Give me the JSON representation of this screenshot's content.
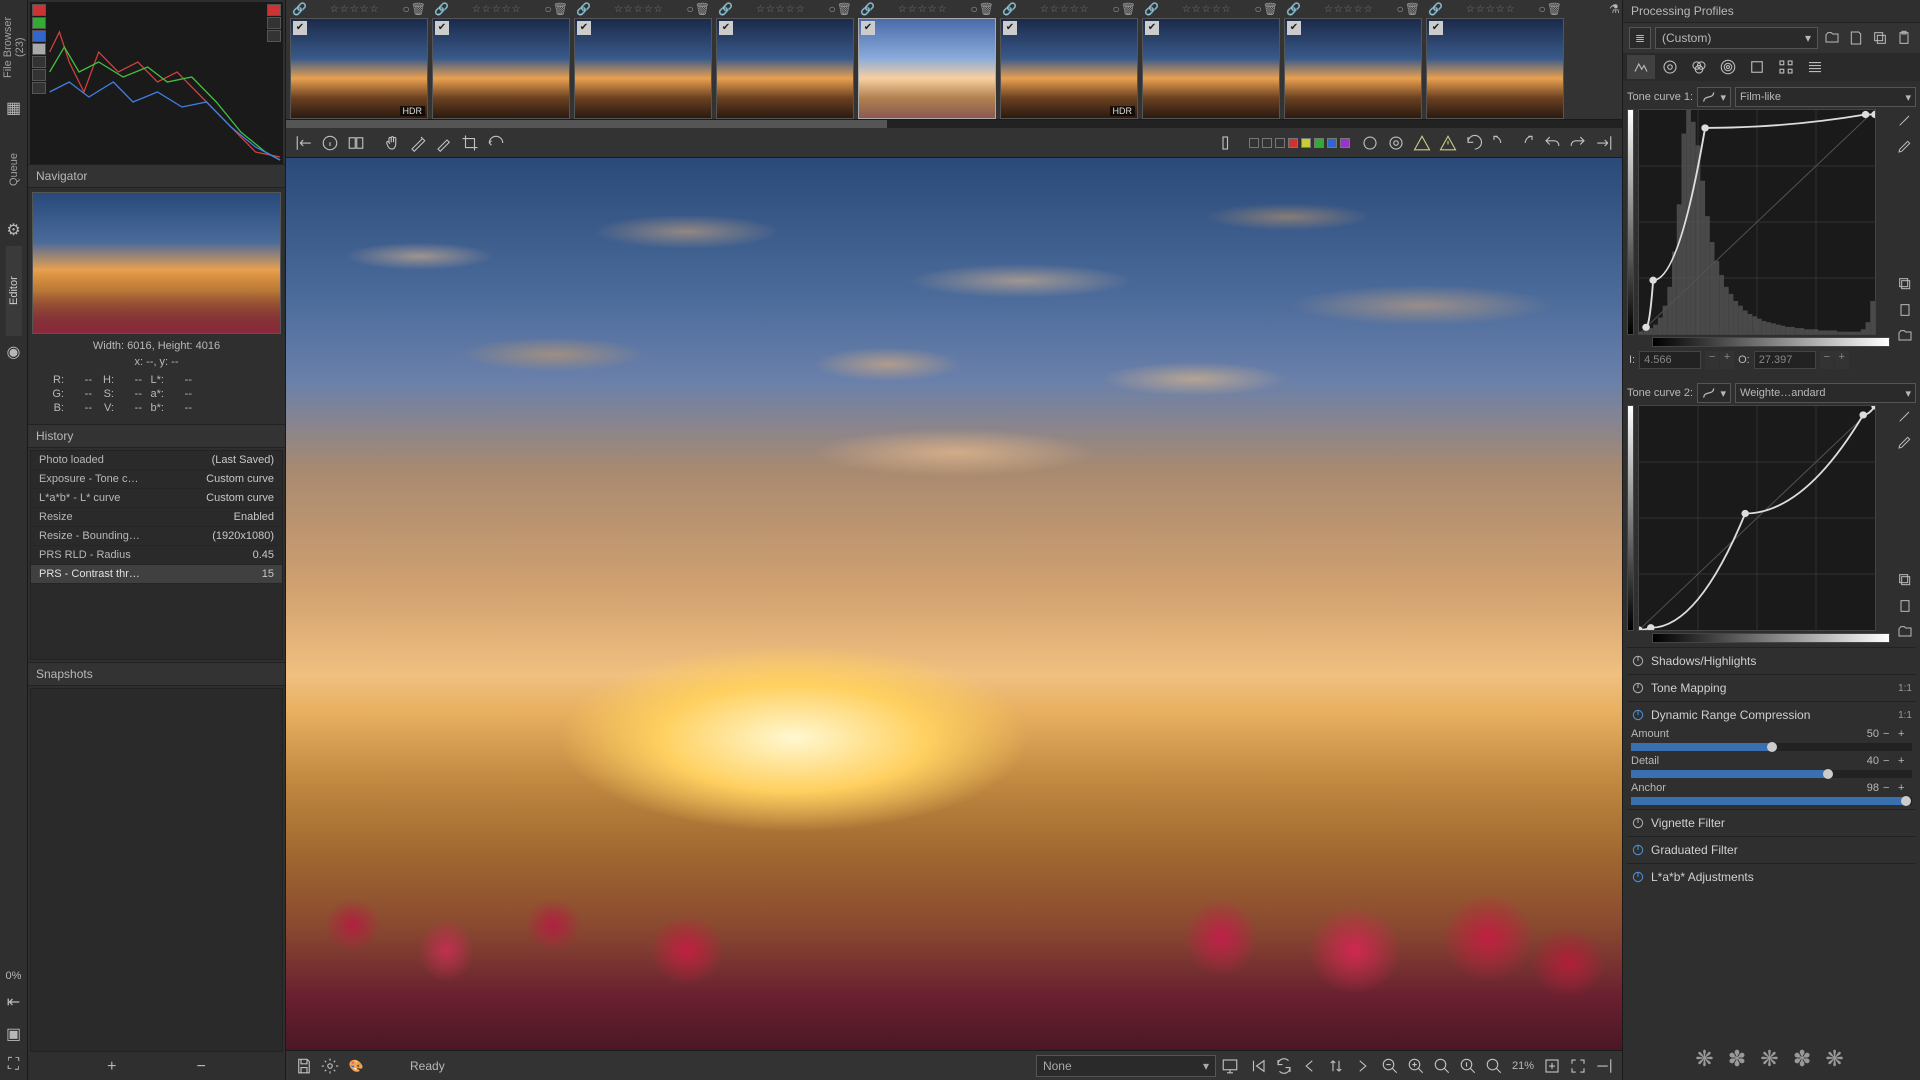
{
  "leftbar": {
    "tabs": [
      "File Browser (23)",
      "Queue",
      "Editor"
    ],
    "active_tab": 2,
    "queue_pct": "0%"
  },
  "navigator": {
    "title": "Navigator",
    "dimensions": "Width: 6016, Height: 4016",
    "xy": "x: --, y: --",
    "r_label": "R:",
    "r_val": "--",
    "g_label": "G:",
    "g_val": "--",
    "b_label": "B:",
    "b_val": "--",
    "h_label": "H:",
    "h_val": "--",
    "s_label": "S:",
    "s_val": "--",
    "v_label": "V:",
    "v_val": "--",
    "l_label": "L*:",
    "l_val": "--",
    "a_label": "a*:",
    "a_val": "--",
    "bb_label": "b*:",
    "bb_val": "--"
  },
  "history": {
    "title": "History",
    "items": [
      {
        "label": "Photo loaded",
        "value": "(Last Saved)"
      },
      {
        "label": "Exposure - Tone c…",
        "value": "Custom curve"
      },
      {
        "label": "L*a*b* - L* curve",
        "value": "Custom curve"
      },
      {
        "label": "Resize",
        "value": "Enabled"
      },
      {
        "label": "Resize - Bounding…",
        "value": "(1920x1080)"
      },
      {
        "label": "PRS RLD - Radius",
        "value": "0.45"
      },
      {
        "label": "PRS - Contrast thr…",
        "value": "15"
      }
    ],
    "selected": 6
  },
  "snapshots": {
    "title": "Snapshots",
    "add": "+",
    "remove": "−"
  },
  "filmstrip": {
    "thumbs": [
      {
        "checked": true,
        "badge": "HDR"
      },
      {
        "checked": true
      },
      {
        "checked": true
      },
      {
        "checked": true
      },
      {
        "checked": true,
        "selected": true
      },
      {
        "checked": true,
        "badge": "HDR"
      },
      {
        "checked": true
      },
      {
        "checked": true
      },
      {
        "checked": true
      }
    ]
  },
  "bottombar": {
    "status": "Ready",
    "bg_select": "None",
    "zoom": "21%"
  },
  "profiles": {
    "header": "Processing Profiles",
    "current": "(Custom)"
  },
  "tone_curve_1": {
    "label": "Tone curve 1:",
    "type": "Film-like",
    "i_label": "I:",
    "i_value": "4.566",
    "o_label": "O:",
    "o_value": "27.397",
    "histogram": [
      2,
      3,
      5,
      8,
      14,
      24,
      40,
      70,
      110,
      170,
      190,
      180,
      160,
      130,
      100,
      78,
      62,
      50,
      40,
      34,
      28,
      24,
      20,
      17,
      15,
      13,
      11,
      10,
      9,
      8,
      7,
      6,
      6,
      5,
      5,
      4,
      4,
      4,
      3,
      3,
      3,
      3,
      2,
      2,
      2,
      2,
      2,
      4,
      10,
      28
    ],
    "curve_points": [
      [
        0.03,
        0.97
      ],
      [
        0.06,
        0.76
      ],
      [
        0.28,
        0.08
      ],
      [
        0.96,
        0.02
      ],
      [
        1.0,
        0.02
      ]
    ]
  },
  "tone_curve_2": {
    "label": "Tone curve 2:",
    "type": "Weighte…andard",
    "curve_points": [
      [
        0.0,
        1.0
      ],
      [
        0.05,
        0.99
      ],
      [
        0.45,
        0.48
      ],
      [
        0.95,
        0.04
      ],
      [
        1.0,
        0.0
      ]
    ]
  },
  "modules": {
    "shadows_highlights": {
      "label": "Shadows/Highlights",
      "on": false
    },
    "tone_mapping": {
      "label": "Tone Mapping",
      "on": false,
      "ratio": "1:1"
    },
    "drc": {
      "label": "Dynamic Range Compression",
      "on": true,
      "ratio": "1:1",
      "params": [
        {
          "label": "Amount",
          "value": 50,
          "min": 0,
          "max": 100
        },
        {
          "label": "Detail",
          "value": 40,
          "min": -100,
          "max": 100
        },
        {
          "label": "Anchor",
          "value": 98,
          "min": 0,
          "max": 100
        }
      ]
    },
    "vignette": {
      "label": "Vignette Filter",
      "on": false
    },
    "graduated": {
      "label": "Graduated Filter",
      "on": true
    },
    "lab": {
      "label": "L*a*b* Adjustments",
      "on": true
    }
  },
  "colors": {
    "accent": "#3a70b0"
  }
}
